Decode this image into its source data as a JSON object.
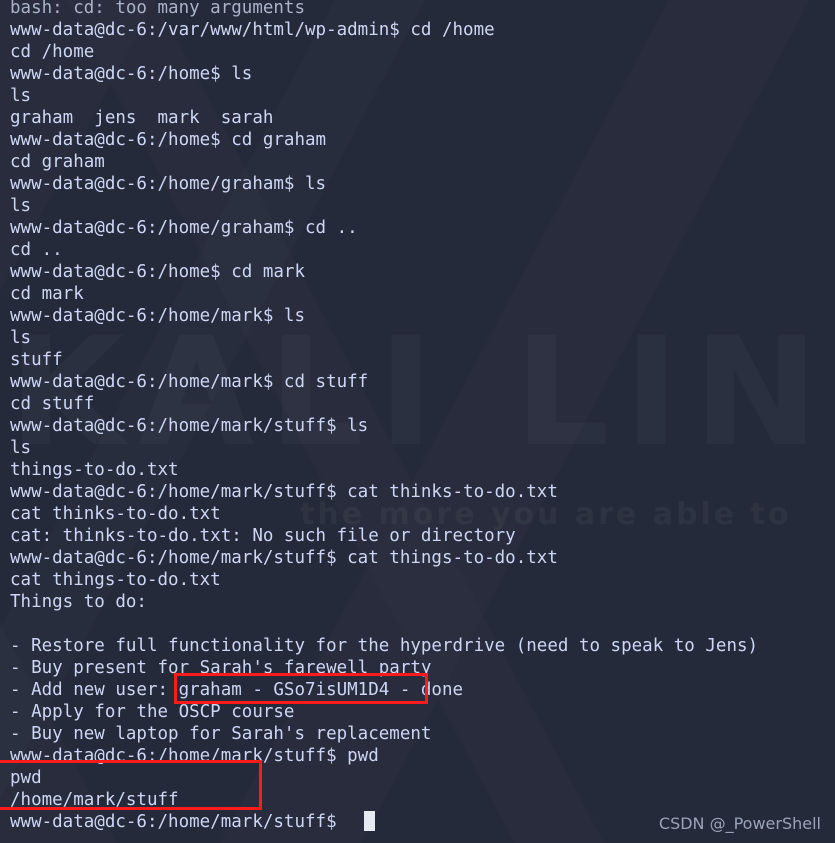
{
  "terminal": {
    "background_color": "#252a3a",
    "text_color": "#cdd6f4",
    "highlight_color": "#fb1b1b",
    "cursor": "block-cursor",
    "prompt_user": "www-data@dc-6",
    "lines": [
      "bash: cd: too many arguments",
      "www-data@dc-6:/var/www/html/wp-admin$ cd /home",
      "cd /home",
      "www-data@dc-6:/home$ ls",
      "ls",
      "graham  jens  mark  sarah",
      "www-data@dc-6:/home$ cd graham",
      "cd graham",
      "www-data@dc-6:/home/graham$ ls",
      "ls",
      "www-data@dc-6:/home/graham$ cd ..",
      "cd ..",
      "www-data@dc-6:/home$ cd mark",
      "cd mark",
      "www-data@dc-6:/home/mark$ ls",
      "ls",
      "stuff",
      "www-data@dc-6:/home/mark$ cd stuff",
      "cd stuff",
      "www-data@dc-6:/home/mark/stuff$ ls",
      "ls",
      "things-to-do.txt",
      "www-data@dc-6:/home/mark/stuff$ cat thinks-to-do.txt",
      "cat thinks-to-do.txt",
      "cat: thinks-to-do.txt: No such file or directory",
      "www-data@dc-6:/home/mark/stuff$ cat things-to-do.txt",
      "cat things-to-do.txt",
      "Things to do:",
      "",
      "- Restore full functionality for the hyperdrive (need to speak to Jens)",
      "- Buy present for Sarah's farewell party",
      "- Add new user: graham - GSo7isUM1D4 - done",
      "- Apply for the OSCP course",
      "- Buy new laptop for Sarah's replacement",
      "www-data@dc-6:/home/mark/stuff$ pwd",
      "pwd",
      "/home/mark/stuff",
      "www-data@dc-6:/home/mark/stuff$ "
    ]
  },
  "annotations": {
    "password_box_label": "graham - GSo7isUM1D4",
    "pwd_box_label": "pwd /home/mark/stuff"
  },
  "watermarks": {
    "kali": "KALI LINUX",
    "tagline": "the more you are able to",
    "credit": "CSDN @_PowerShell"
  }
}
